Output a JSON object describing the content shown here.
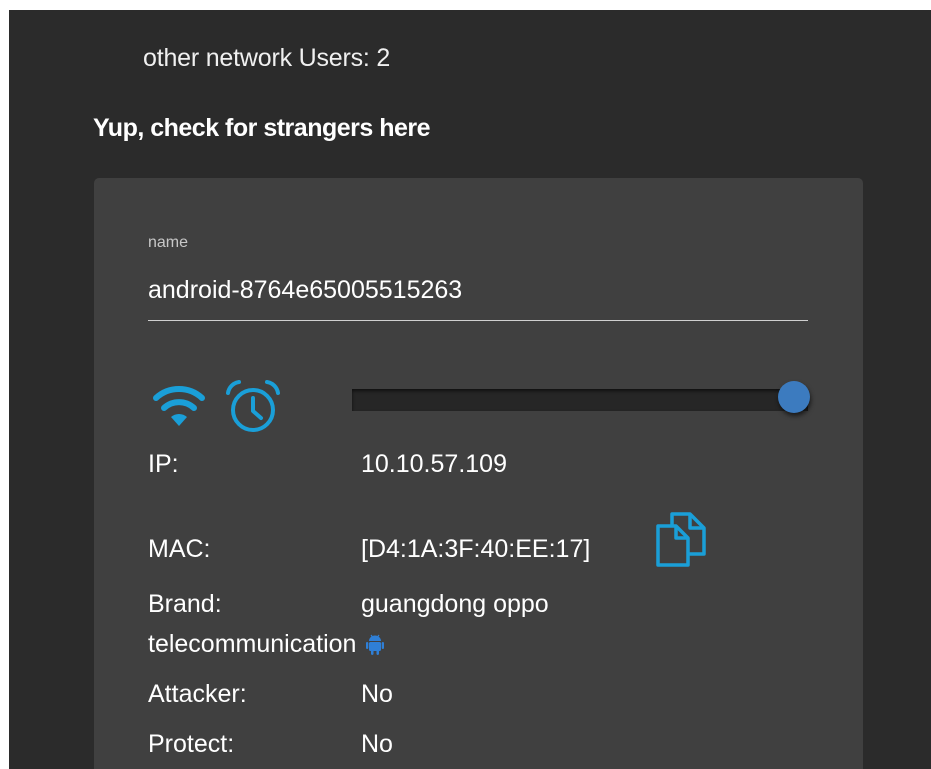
{
  "header": {
    "other_users_label": "other network Users: 2",
    "strangers_title": "Yup, check for strangers here"
  },
  "device": {
    "name_label": "name",
    "name_value": "android-8764e65005515263",
    "slider_value_pct": 97,
    "ip_label": "IP:",
    "ip_value": "10.10.57.109",
    "mac_label": "MAC:",
    "mac_value": "[D4:1A:3F:40:EE:17]",
    "brand_label": "Brand:",
    "brand_value_line1": "guangdong oppo",
    "brand_value_line2": "telecommunication",
    "attacker_label": "Attacker:",
    "attacker_value": "No",
    "protect_label": "Protect:",
    "protect_value": "No"
  },
  "icons": {
    "connection": "wifi-icon",
    "schedule": "alarm-clock-icon",
    "copy": "copy-icon",
    "os": "android-icon"
  },
  "colors": {
    "accent": "#1a9fd8",
    "android": "#2f7fd6",
    "slider_thumb": "#3c7bbf",
    "panel_bg": "#2b2b2b",
    "card_bg": "#404040"
  }
}
